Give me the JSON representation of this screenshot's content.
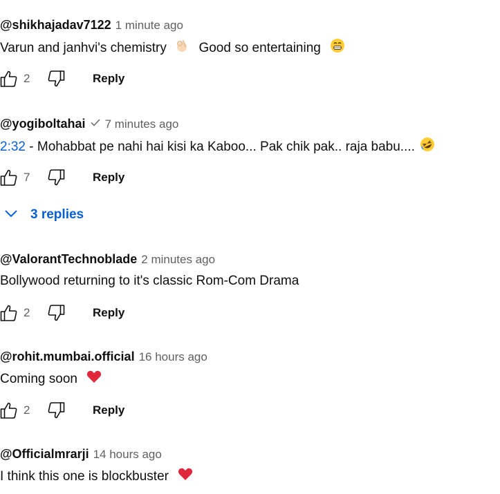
{
  "comments": [
    {
      "author": "@shikhajadav7122",
      "time": "1 minute ago",
      "text_before": "Varun and janhvi's chemistry",
      "emoji_mid": "ok-hand-emoji",
      "text_after": "Good so entertaining",
      "emoji_end": "grinning-emoji",
      "likes": "2",
      "reply_label": "Reply"
    },
    {
      "author": "@yogiboltahai",
      "verified": true,
      "time": "7 minutes ago",
      "timestamp_link": "2:32",
      "text": " - Mohabbat pe nahi hai kisi ka Kaboo... Pak chik pak.. raja babu....",
      "emoji_end": "rofl-emoji",
      "likes": "7",
      "reply_label": "Reply",
      "replies_label": "3 replies"
    },
    {
      "author": "@ValorantTechnoblade",
      "time": "2 minutes ago",
      "text": "Bollywood returning to it's classic Rom-Com Drama",
      "likes": "2",
      "reply_label": "Reply"
    },
    {
      "author": "@rohit.mumbai.official",
      "time": "16 hours ago",
      "text": "Coming soon",
      "emoji_end": "heart-emoji",
      "likes": "2",
      "reply_label": "Reply"
    },
    {
      "author": "@Officialmrarji",
      "time": "14 hours ago",
      "text": "I think this one is blockbuster",
      "emoji_end": "heart-emoji"
    }
  ],
  "colors": {
    "link": "#065fd4",
    "secondary_text": "#606060",
    "primary_text": "#0f0f0f",
    "heart": "#e0263a"
  }
}
